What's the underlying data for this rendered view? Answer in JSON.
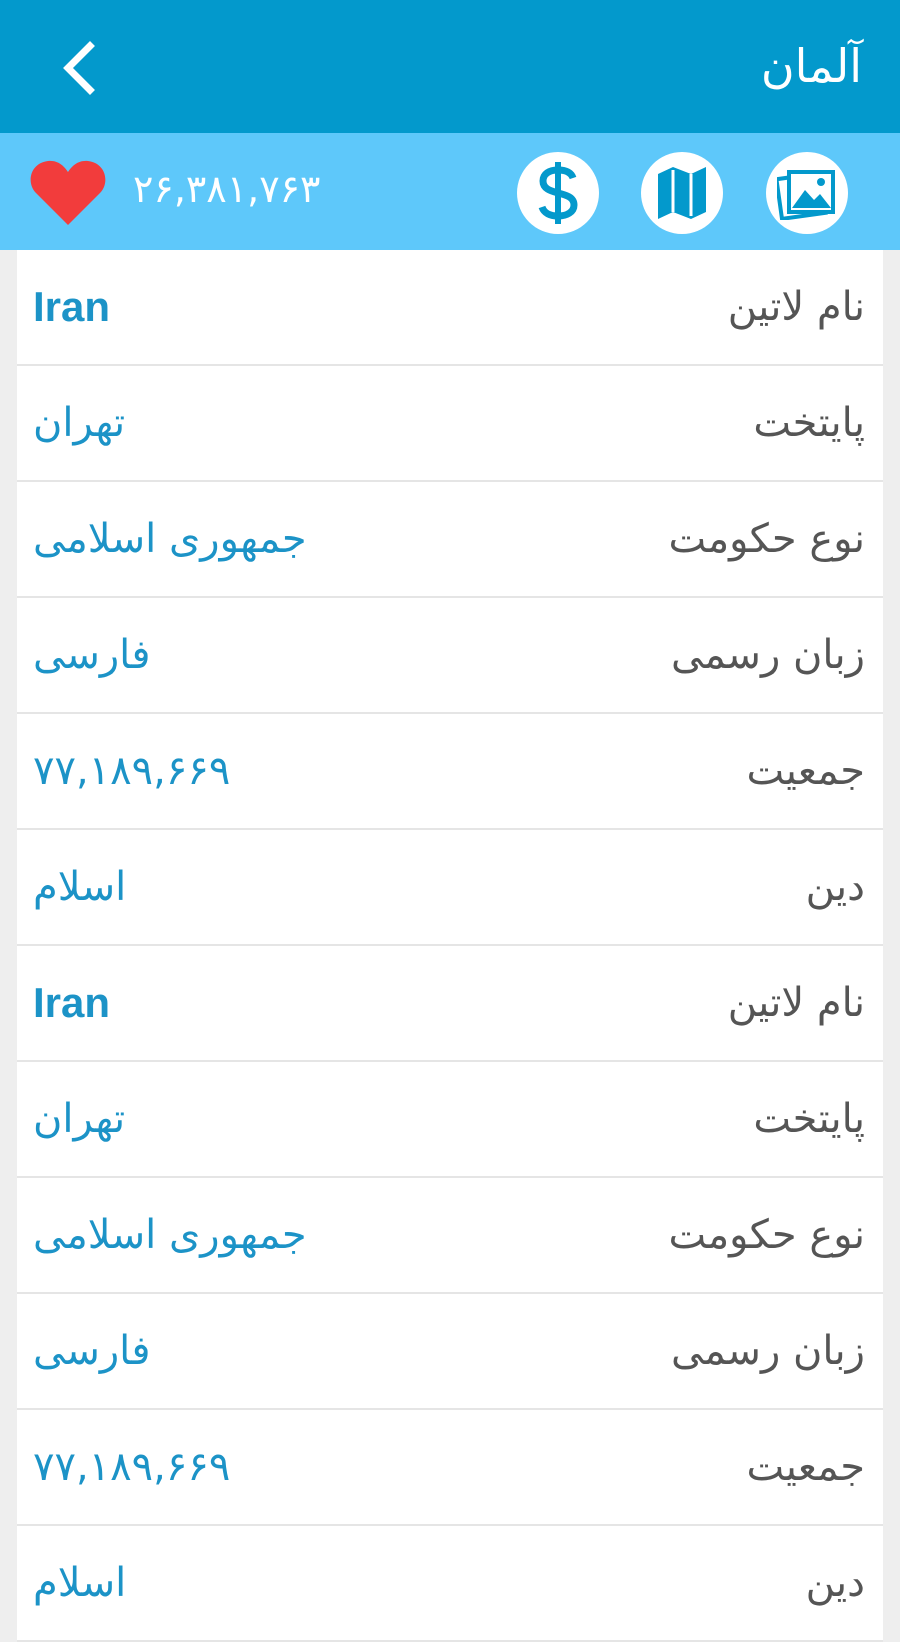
{
  "app_bar": {
    "title": "آلمان",
    "back_icon": "chevron-left-icon"
  },
  "toolbar": {
    "likes_count": "۲۶,۳۸۱,۷۶۳",
    "heart_color": "#f23c3c",
    "icons": [
      "heart-icon",
      "dollar-icon",
      "map-icon",
      "gallery-icon"
    ]
  },
  "rows": [
    {
      "label": "نام لاتین",
      "value": "Iran"
    },
    {
      "label": "پایتخت",
      "value": "تهران"
    },
    {
      "label": "نوع حکومت",
      "value": "جمهوری اسلامی"
    },
    {
      "label": "زبان رسمی",
      "value": "فارسی"
    },
    {
      "label": "جمعیت",
      "value": "۷۷,۱۸۹,۶۶۹"
    },
    {
      "label": "دین",
      "value": "اسلام"
    },
    {
      "label": "نام لاتین",
      "value": "Iran"
    },
    {
      "label": "پایتخت",
      "value": "تهران"
    },
    {
      "label": "نوع حکومت",
      "value": "جمهوری اسلامی"
    },
    {
      "label": "زبان رسمی",
      "value": "فارسی"
    },
    {
      "label": "جمعیت",
      "value": "۷۷,۱۸۹,۶۶۹"
    },
    {
      "label": "دین",
      "value": "اسلام"
    }
  ],
  "colors": {
    "app_bar": "#0399cc",
    "toolbar": "#5ec8fa",
    "value_text": "#1c93c7",
    "label_text": "#555555"
  }
}
